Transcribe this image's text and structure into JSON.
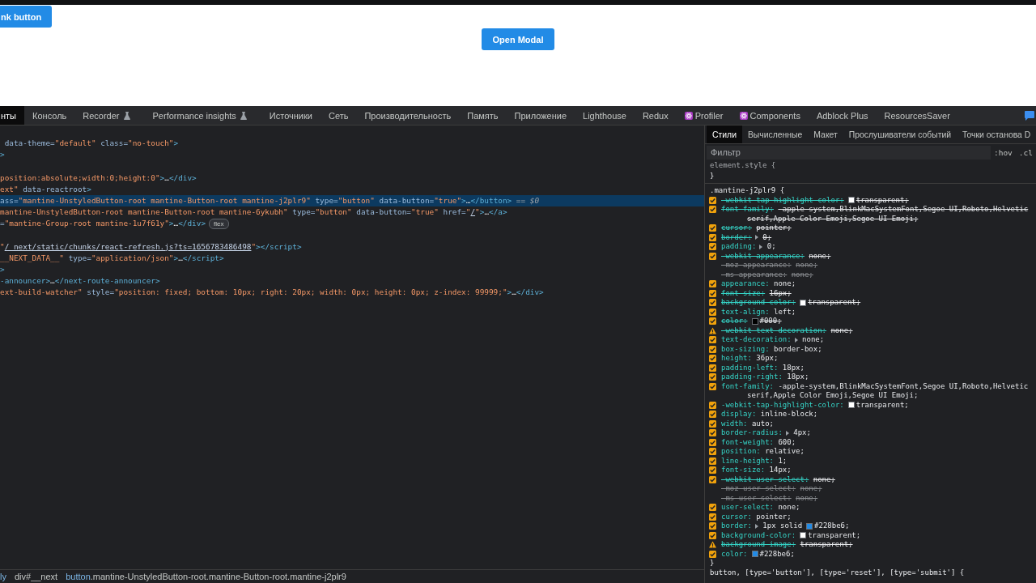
{
  "page": {
    "link_button": {
      "label": "nk button"
    },
    "modal_button": {
      "label": "Open Modal"
    }
  },
  "devtools": {
    "tabs": [
      {
        "label": "нты",
        "selected": true,
        "kind": "plain"
      },
      {
        "label": "Консоль",
        "selected": false,
        "kind": "plain"
      },
      {
        "label": "Recorder",
        "selected": false,
        "kind": "experiment"
      },
      {
        "label": "Performance insights",
        "selected": false,
        "kind": "experiment"
      },
      {
        "label": "Источники",
        "selected": false,
        "kind": "plain"
      },
      {
        "label": "Сеть",
        "selected": false,
        "kind": "plain"
      },
      {
        "label": "Производительность",
        "selected": false,
        "kind": "plain"
      },
      {
        "label": "Память",
        "selected": false,
        "kind": "plain"
      },
      {
        "label": "Приложение",
        "selected": false,
        "kind": "plain"
      },
      {
        "label": "Lighthouse",
        "selected": false,
        "kind": "plain"
      },
      {
        "label": "Redux",
        "selected": false,
        "kind": "plain"
      },
      {
        "label": "Profiler",
        "selected": false,
        "kind": "extension"
      },
      {
        "label": "Components",
        "selected": false,
        "kind": "extension"
      },
      {
        "label": "Adblock Plus",
        "selected": false,
        "kind": "plain"
      },
      {
        "label": "ResourcesSaver",
        "selected": false,
        "kind": "plain"
      }
    ],
    "elements": {
      "lines": [
        {
          "selected": false,
          "segments": [
            {
              "kind": "attr",
              "text": " data-theme="
            },
            {
              "kind": "value",
              "text": "\"default\""
            },
            {
              "kind": "attr",
              "text": " class="
            },
            {
              "kind": "value",
              "text": "\"no-touch\""
            },
            {
              "kind": "tag",
              "text": ">"
            }
          ]
        },
        {
          "selected": false,
          "segments": [
            {
              "kind": "tag",
              "text": ">"
            }
          ]
        },
        {
          "selected": false,
          "gap_before": true,
          "segments": [
            {
              "kind": "value",
              "text": "position:absolute;width:0;height:0\""
            },
            {
              "kind": "tag",
              "text": ">"
            },
            {
              "kind": "text",
              "text": "…"
            },
            {
              "kind": "tag",
              "text": "</div>"
            }
          ]
        },
        {
          "selected": false,
          "segments": [
            {
              "kind": "value",
              "text": "ext\""
            },
            {
              "kind": "attr",
              "text": " data-reactroot"
            },
            {
              "kind": "tag",
              "text": ">"
            }
          ]
        },
        {
          "selected": true,
          "segments": [
            {
              "kind": "attr",
              "text": "ass="
            },
            {
              "kind": "value",
              "text": "\"mantine-UnstyledButton-root mantine-Button-root mantine-j2plr9\""
            },
            {
              "kind": "attr",
              "text": " type="
            },
            {
              "kind": "value",
              "text": "\"button\""
            },
            {
              "kind": "attr",
              "text": " data-button="
            },
            {
              "kind": "value",
              "text": "\"true\""
            },
            {
              "kind": "tag",
              "text": ">"
            },
            {
              "kind": "text",
              "text": "…"
            },
            {
              "kind": "tag",
              "text": "</button>"
            },
            {
              "kind": "note",
              "text": " == $0"
            }
          ]
        },
        {
          "selected": false,
          "segments": [
            {
              "kind": "value",
              "text": "mantine-UnstyledButton-root mantine-Button-root mantine-6ykubh\""
            },
            {
              "kind": "attr",
              "text": " type="
            },
            {
              "kind": "value",
              "text": "\"button\""
            },
            {
              "kind": "attr",
              "text": " data-button="
            },
            {
              "kind": "value",
              "text": "\"true\""
            },
            {
              "kind": "attr",
              "text": " href="
            },
            {
              "kind": "value",
              "text": "\""
            },
            {
              "kind": "link",
              "text": "/"
            },
            {
              "kind": "value",
              "text": "\""
            },
            {
              "kind": "tag",
              "text": ">"
            },
            {
              "kind": "text",
              "text": "…"
            },
            {
              "kind": "tag",
              "text": "</a>"
            }
          ]
        },
        {
          "selected": false,
          "badge": "flex",
          "segments": [
            {
              "kind": "attr",
              "text": "="
            },
            {
              "kind": "value",
              "text": "\"mantine-Group-root mantine-1u7f61y\""
            },
            {
              "kind": "tag",
              "text": ">"
            },
            {
              "kind": "text",
              "text": "…"
            },
            {
              "kind": "tag",
              "text": "</div>"
            }
          ]
        },
        {
          "selected": false,
          "gap_before": true,
          "segments": [
            {
              "kind": "value",
              "text": "\""
            },
            {
              "kind": "link",
              "text": "/_next/static/chunks/react-refresh.js?ts=1656783486498"
            },
            {
              "kind": "value",
              "text": "\""
            },
            {
              "kind": "tag",
              "text": "></script>"
            }
          ]
        },
        {
          "selected": false,
          "segments": [
            {
              "kind": "value",
              "text": "__NEXT_DATA__\""
            },
            {
              "kind": "attr",
              "text": " type="
            },
            {
              "kind": "value",
              "text": "\"application/json\""
            },
            {
              "kind": "tag",
              "text": ">"
            },
            {
              "kind": "text",
              "text": "…"
            },
            {
              "kind": "tag",
              "text": "</script>"
            }
          ]
        },
        {
          "selected": false,
          "segments": [
            {
              "kind": "tag",
              "text": ">"
            }
          ]
        },
        {
          "selected": false,
          "segments": [
            {
              "kind": "tag",
              "text": "-announcer>"
            },
            {
              "kind": "text",
              "text": "…"
            },
            {
              "kind": "tag",
              "text": "</next-route-announcer>"
            }
          ]
        },
        {
          "selected": false,
          "segments": [
            {
              "kind": "value",
              "text": "ext-build-watcher\""
            },
            {
              "kind": "attr",
              "text": " style="
            },
            {
              "kind": "value",
              "text": "\"position: fixed; bottom: 10px; right: 20px; width: 0px; height: 0px; z-index: 99999;\""
            },
            {
              "kind": "tag",
              "text": ">"
            },
            {
              "kind": "text",
              "text": "…"
            },
            {
              "kind": "tag",
              "text": "</div>"
            }
          ]
        }
      ]
    },
    "breadcrumbs": [
      {
        "segments": [
          {
            "kind": "tag",
            "text": "ly"
          }
        ]
      },
      {
        "segments": [
          {
            "kind": "text",
            "text": "div#__next"
          }
        ]
      },
      {
        "segments": [
          {
            "kind": "tag",
            "text": "button"
          },
          {
            "kind": "text",
            "text": ".mantine-UnstyledButton-root.mantine-Button-root.mantine-j2plr9"
          }
        ]
      }
    ],
    "styles": {
      "tabs": [
        {
          "label": "Стили",
          "selected": true
        },
        {
          "label": "Вычисленные",
          "selected": false
        },
        {
          "label": "Макет",
          "selected": false
        },
        {
          "label": "Прослушиватели событий",
          "selected": false
        },
        {
          "label": "Точки останова D",
          "selected": false
        }
      ],
      "filter": {
        "placeholder": "Фильтр"
      },
      "filter_buttons": [
        ":hov",
        ".cl"
      ],
      "element_style": {
        "selector": "element.style {",
        "close": "}"
      },
      "rule": {
        "selector": ".mantine-j2plr9 {",
        "close": "}",
        "props": [
          {
            "kind": "checkbox",
            "checked": true,
            "struck": true,
            "name": "-webkit-tap-highlight-color:",
            "color": "#ffffff",
            "value": "transparent;"
          },
          {
            "kind": "checkbox",
            "checked": true,
            "struck": true,
            "name": "font-family:",
            "value": "-apple-system,BlinkMacSystemFont,Segoe UI,Roboto,Helvetic",
            "continuation": "serif,Apple Color Emoji,Segoe UI Emoji;"
          },
          {
            "kind": "checkbox",
            "checked": true,
            "struck": true,
            "name": "cursor:",
            "value": "pointer;"
          },
          {
            "kind": "checkbox",
            "checked": true,
            "struck": true,
            "name": "border:",
            "expandable": true,
            "value": "0;"
          },
          {
            "kind": "checkbox",
            "checked": true,
            "struck": false,
            "name": "padding:",
            "expandable": true,
            "value": "0;"
          },
          {
            "kind": "checkbox",
            "checked": true,
            "struck": true,
            "name": "-webkit-appearance:",
            "value": "none;"
          },
          {
            "kind": "inactive",
            "struck": true,
            "name": "-moz-appearance:",
            "value": "none;"
          },
          {
            "kind": "inactive",
            "struck": true,
            "name": "-ms-appearance:",
            "value": "none;"
          },
          {
            "kind": "checkbox",
            "checked": true,
            "struck": false,
            "name": "appearance:",
            "value": "none;"
          },
          {
            "kind": "checkbox",
            "checked": true,
            "struck": true,
            "name": "font-size:",
            "value": "16px;"
          },
          {
            "kind": "checkbox",
            "checked": true,
            "struck": true,
            "name": "background-color:",
            "color": "#ffffff",
            "value": "transparent;"
          },
          {
            "kind": "checkbox",
            "checked": true,
            "struck": false,
            "name": "text-align:",
            "value": "left;"
          },
          {
            "kind": "checkbox",
            "checked": true,
            "struck": true,
            "name": "color:",
            "color": "#000000",
            "value": "#000;"
          },
          {
            "kind": "warning",
            "struck": true,
            "name": "-webkit-text-decoration:",
            "value": "none;"
          },
          {
            "kind": "checkbox",
            "checked": true,
            "struck": false,
            "name": "text-decoration:",
            "expandable": true,
            "value": "none;"
          },
          {
            "kind": "checkbox",
            "checked": true,
            "struck": false,
            "name": "box-sizing:",
            "value": "border-box;"
          },
          {
            "kind": "checkbox",
            "checked": true,
            "struck": false,
            "name": "height:",
            "value": "36px;"
          },
          {
            "kind": "checkbox",
            "checked": true,
            "struck": false,
            "name": "padding-left:",
            "value": "18px;"
          },
          {
            "kind": "checkbox",
            "checked": true,
            "struck": false,
            "name": "padding-right:",
            "value": "18px;"
          },
          {
            "kind": "checkbox",
            "checked": true,
            "struck": false,
            "name": "font-family:",
            "value": "-apple-system,BlinkMacSystemFont,Segoe UI,Roboto,Helvetic",
            "continuation": "serif,Apple Color Emoji,Segoe UI Emoji;"
          },
          {
            "kind": "checkbox",
            "checked": true,
            "struck": false,
            "name": "-webkit-tap-highlight-color:",
            "color": "#ffffff",
            "value": "transparent;"
          },
          {
            "kind": "checkbox",
            "checked": true,
            "struck": false,
            "name": "display:",
            "value": "inline-block;"
          },
          {
            "kind": "checkbox",
            "checked": true,
            "struck": false,
            "name": "width:",
            "value": "auto;"
          },
          {
            "kind": "checkbox",
            "checked": true,
            "struck": false,
            "name": "border-radius:",
            "expandable": true,
            "value": "4px;"
          },
          {
            "kind": "checkbox",
            "checked": true,
            "struck": false,
            "name": "font-weight:",
            "value": "600;"
          },
          {
            "kind": "checkbox",
            "checked": true,
            "struck": false,
            "name": "position:",
            "value": "relative;"
          },
          {
            "kind": "checkbox",
            "checked": true,
            "struck": false,
            "name": "line-height:",
            "value": "1;"
          },
          {
            "kind": "checkbox",
            "checked": true,
            "struck": false,
            "name": "font-size:",
            "value": "14px;"
          },
          {
            "kind": "checkbox",
            "checked": true,
            "struck": true,
            "name": "-webkit-user-select:",
            "value": "none;"
          },
          {
            "kind": "inactive",
            "struck": true,
            "name": "-moz-user-select:",
            "value": "none;"
          },
          {
            "kind": "inactive",
            "struck": true,
            "name": "-ms-user-select:",
            "value": "none;"
          },
          {
            "kind": "checkbox",
            "checked": true,
            "struck": false,
            "name": "user-select:",
            "value": "none;"
          },
          {
            "kind": "checkbox",
            "checked": true,
            "struck": false,
            "name": "cursor:",
            "value": "pointer;"
          },
          {
            "kind": "checkbox",
            "checked": true,
            "struck": false,
            "name": "border:",
            "expandable": true,
            "prefix": "1px solid",
            "color": "#228be6",
            "value": "#228be6;"
          },
          {
            "kind": "checkbox",
            "checked": true,
            "struck": false,
            "name": "background-color:",
            "color": "#ffffff",
            "value": "transparent;"
          },
          {
            "kind": "warning",
            "struck": true,
            "name": "background-image:",
            "value": "transparent;"
          },
          {
            "kind": "checkbox",
            "checked": true,
            "struck": false,
            "name": "color:",
            "color": "#228be6",
            "value": "#228be6;"
          }
        ]
      },
      "next_rule": {
        "selector": "button, [type='button'], [type='reset'], [type='submit'] {"
      }
    }
  }
}
